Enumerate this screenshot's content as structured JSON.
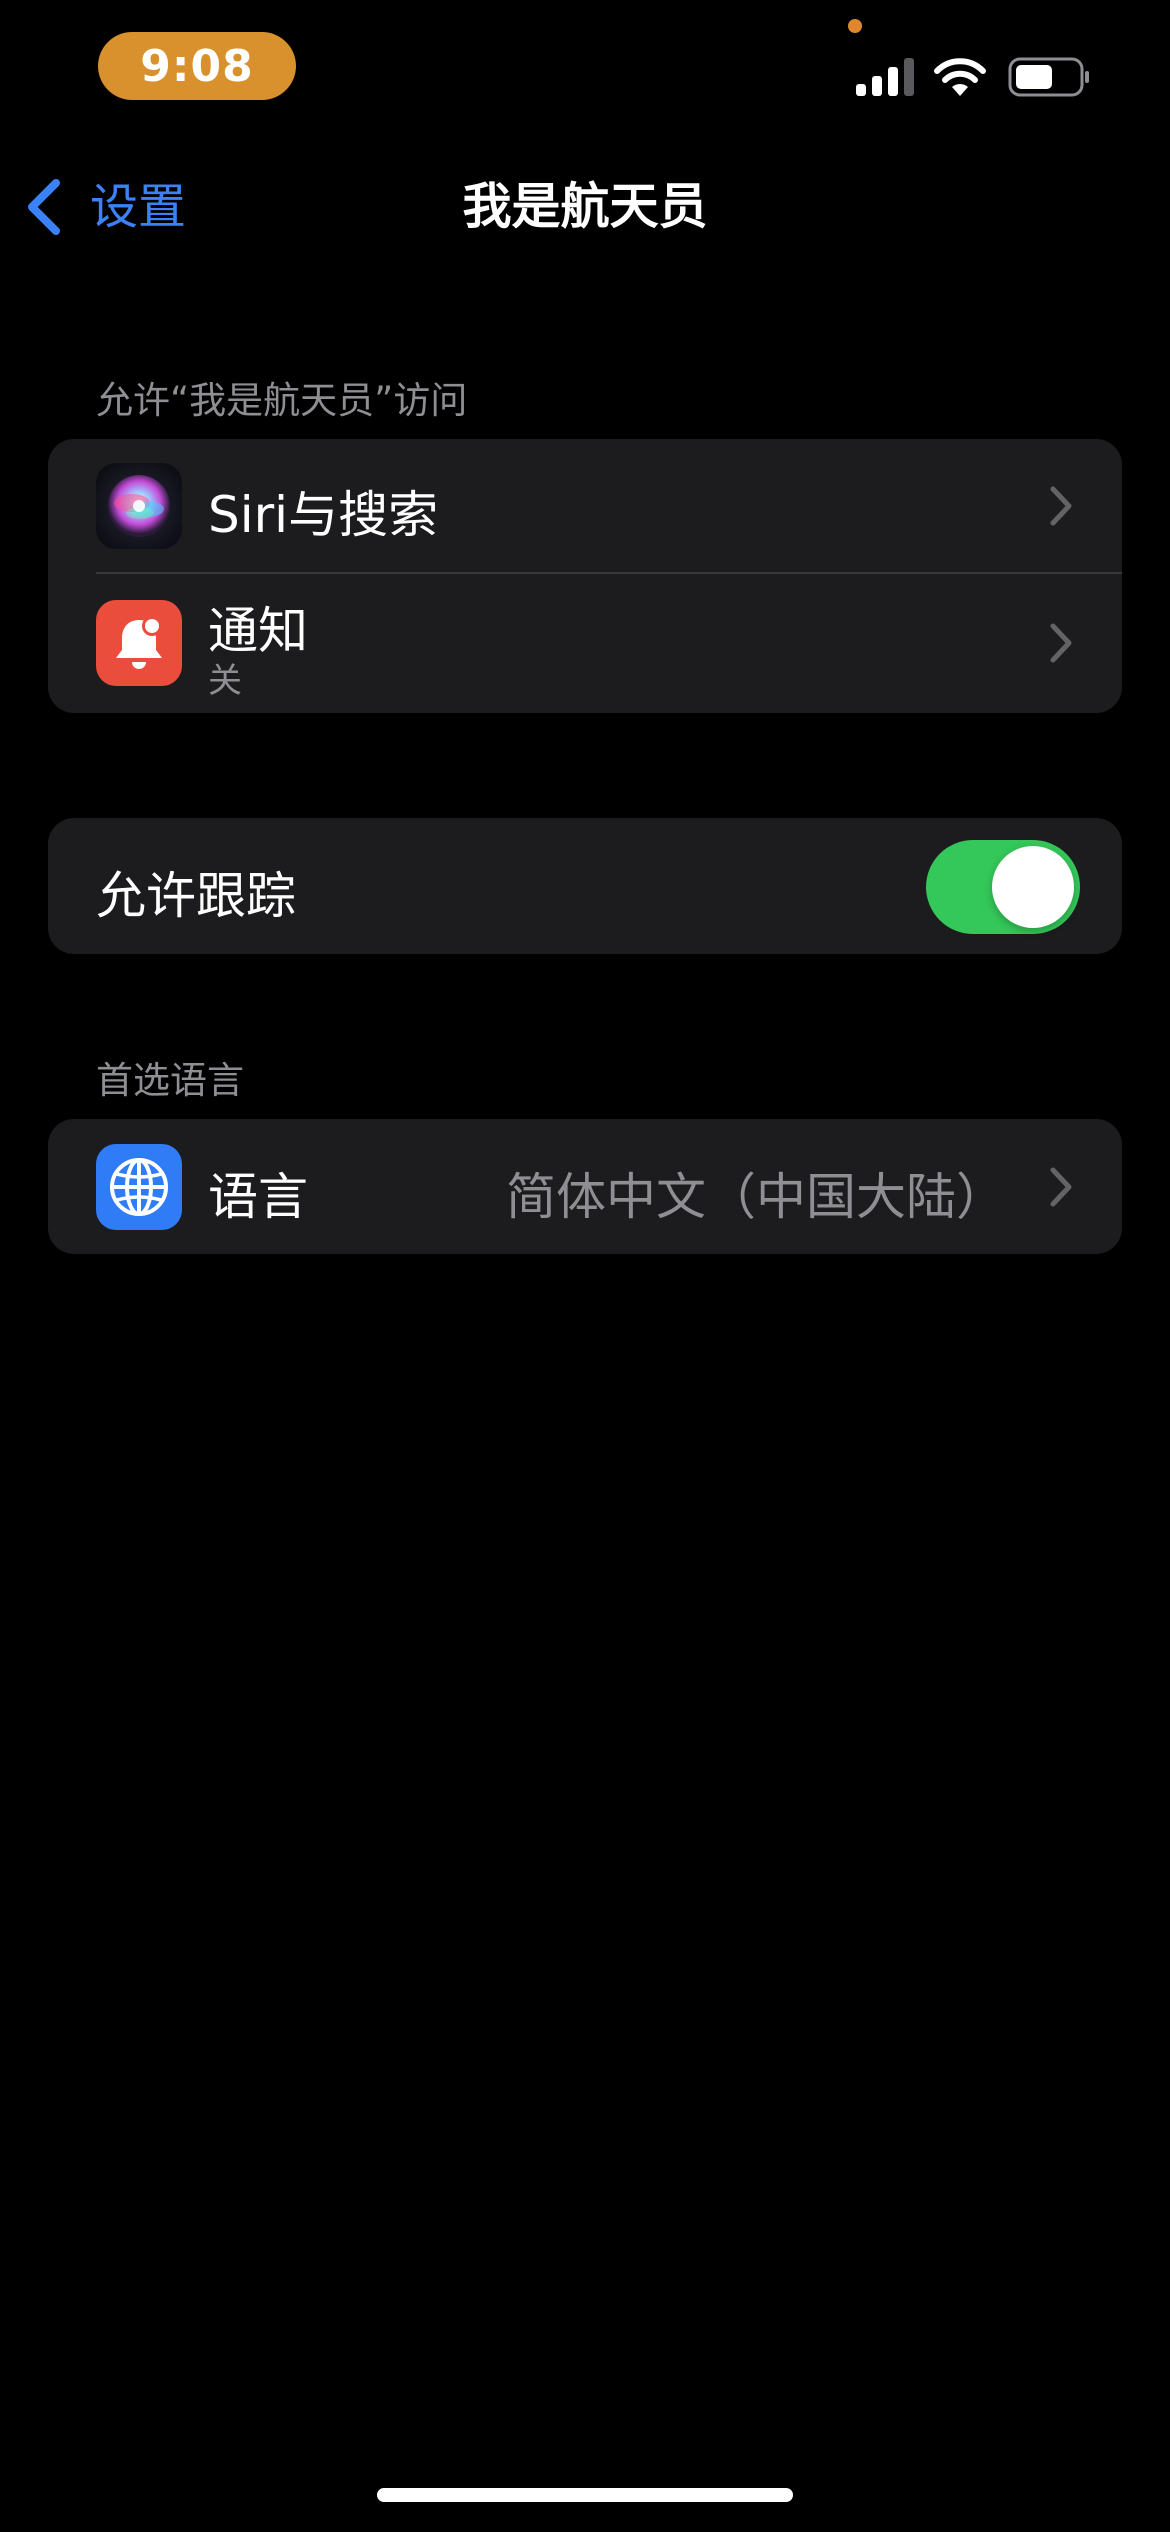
{
  "status_bar": {
    "time": "9:08",
    "time_pill_color": "#D9912D",
    "privacy_indicator_color": "#E0872E",
    "icons": [
      "signal-icon",
      "wifi-icon",
      "battery-icon"
    ],
    "battery_level": 0.55
  },
  "nav": {
    "back_label": "设置",
    "title": "我是航天员",
    "accent_color": "#3B82F6"
  },
  "access_section": {
    "header": "允许“我是航天员”访问",
    "rows": [
      {
        "title": "Siri与搜索",
        "icon": "siri-icon"
      },
      {
        "title": "通知",
        "subtitle": "关",
        "icon": "notification-bell-icon",
        "icon_color": "#EB4D3D"
      }
    ]
  },
  "tracking_section": {
    "label": "允许跟踪",
    "enabled": true,
    "toggle_color": "#34C759"
  },
  "language_section": {
    "header": "首选语言",
    "row": {
      "title": "语言",
      "value": "简体中文（中国大陆）",
      "icon": "globe-icon",
      "icon_color": "#2F7CF6"
    }
  }
}
